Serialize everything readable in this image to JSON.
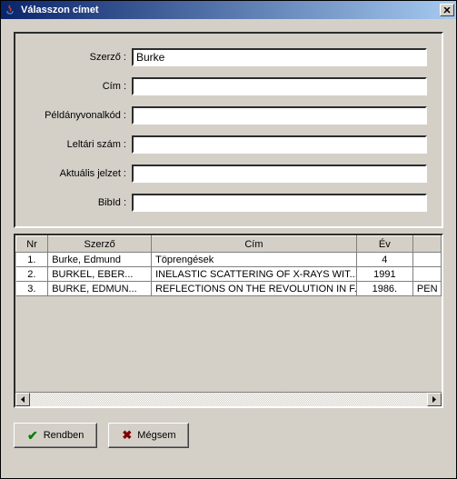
{
  "window": {
    "title": "Válasszon címet"
  },
  "form": {
    "szerzo": {
      "label": "Szerző :",
      "value": "Burke"
    },
    "cim": {
      "label": "Cím :",
      "value": ""
    },
    "peldany": {
      "label": "Példányvonalkód :",
      "value": ""
    },
    "leltari": {
      "label": "Leltári szám :",
      "value": ""
    },
    "aktualis": {
      "label": "Aktuális jelzet :",
      "value": ""
    },
    "bibid": {
      "label": "BibId :",
      "value": ""
    }
  },
  "table": {
    "headers": {
      "nr": "Nr",
      "szerzo": "Szerző",
      "cim": "Cím",
      "ev": "Év",
      "extra": ""
    },
    "rows": [
      {
        "nr": "1.",
        "szerzo": "Burke, Edmund",
        "cim": "Töprengések",
        "ev": "4",
        "extra": ""
      },
      {
        "nr": "2.",
        "szerzo": "BURKEL, EBER...",
        "cim": "INELASTIC SCATTERING OF X-RAYS WIT...",
        "ev": "1991",
        "extra": ""
      },
      {
        "nr": "3.",
        "szerzo": "BURKE, EDMUN...",
        "cim": "REFLECTIONS ON THE REVOLUTION IN F...",
        "ev": "1986.",
        "extra": "PEN"
      }
    ]
  },
  "buttons": {
    "ok": "Rendben",
    "cancel": "Mégsem"
  }
}
